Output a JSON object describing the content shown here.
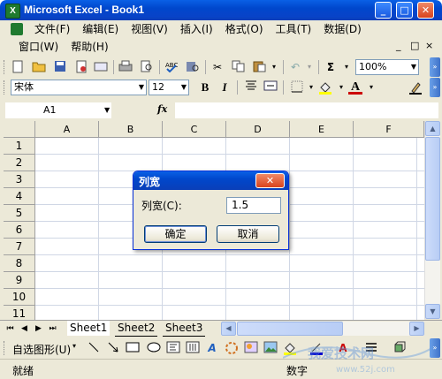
{
  "window": {
    "title": "Microsoft Excel - Book1",
    "app_icon_letter": "X"
  },
  "title_buttons": {
    "minimize": "_",
    "maximize": "□",
    "close": "✕"
  },
  "menu": {
    "row1": [
      "文件(F)",
      "编辑(E)",
      "视图(V)",
      "插入(I)",
      "格式(O)",
      "工具(T)",
      "数据(D)"
    ],
    "row2": [
      "窗口(W)",
      "帮助(H)"
    ],
    "mdi_controls": [
      "_",
      "□",
      "×"
    ]
  },
  "standard_toolbar": {
    "zoom": "100%"
  },
  "format_toolbar": {
    "font_name": "宋体",
    "font_size": "12",
    "bold": "B",
    "italic": "I",
    "underline_color": "#cc0000",
    "fill_color": "#ffff00",
    "font_color_letter": "A"
  },
  "formula_bar": {
    "cell_ref": "A1",
    "fx": "fx"
  },
  "grid": {
    "columns": [
      "A",
      "B",
      "C",
      "D",
      "E",
      "F"
    ],
    "rows": [
      "1",
      "2",
      "3",
      "4",
      "5",
      "6",
      "7",
      "8",
      "9",
      "10",
      "11"
    ]
  },
  "sheet_tabs": [
    "Sheet1",
    "Sheet2",
    "Sheet3"
  ],
  "drawing_toolbar": {
    "autoshapes": "自选图形(U)"
  },
  "status_bar": {
    "left": "就绪",
    "right": "数字"
  },
  "dialog": {
    "title": "列宽",
    "label": "列宽(C):",
    "value": "1.5",
    "ok": "确定",
    "cancel": "取消",
    "close": "✕"
  },
  "watermark": {
    "text": "我爱技术网",
    "url": "www.52j.com"
  },
  "colors": {
    "titlebar": "#0047cc",
    "chrome": "#ece9d8",
    "gridline": "#d0d7e5"
  }
}
